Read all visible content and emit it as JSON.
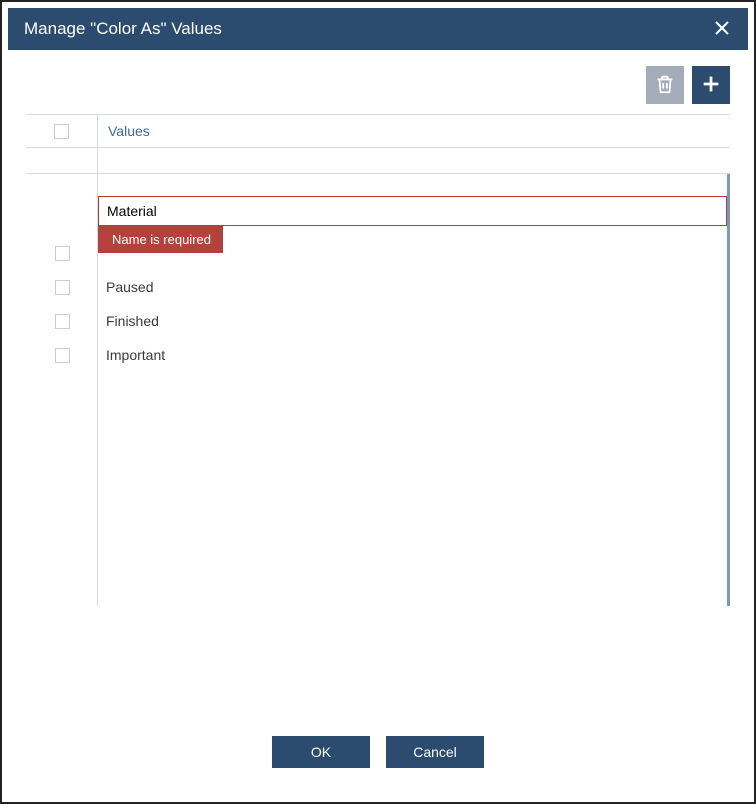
{
  "dialog": {
    "title": "Manage \"Color As\" Values"
  },
  "header": {
    "values_label": "Values"
  },
  "edit": {
    "value": "Material",
    "error": "Name is required"
  },
  "rows": [
    {
      "label": "Paused"
    },
    {
      "label": "Finished"
    },
    {
      "label": "Important"
    }
  ],
  "footer": {
    "ok_label": "OK",
    "cancel_label": "Cancel"
  }
}
